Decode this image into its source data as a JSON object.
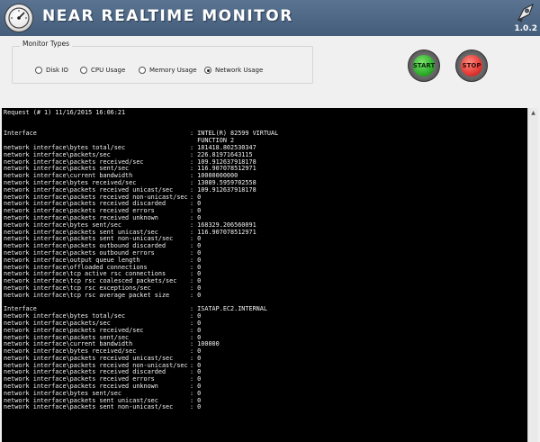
{
  "app": {
    "title": "NEAR REALTIME MONITOR",
    "version": "1.0.2"
  },
  "monitor_types": {
    "group_label": "Monitor Types",
    "options": [
      {
        "label": "Disk IO",
        "selected": false
      },
      {
        "label": "CPU Usage",
        "selected": false
      },
      {
        "label": "Memory Usage",
        "selected": false
      },
      {
        "label": "Network Usage",
        "selected": true
      }
    ]
  },
  "controls": {
    "start_label": "START",
    "stop_label": "STOP"
  },
  "console": {
    "request_line": "Request (# 1) 11/16/2015 16:06:21",
    "lines": [
      {
        "k": "",
        "v": ""
      },
      {
        "k": "",
        "v": ""
      },
      {
        "k": "Interface",
        "v": ": INTEL(R) 82599 VIRTUAL"
      },
      {
        "k": "",
        "v": "  FUNCTION 2"
      },
      {
        "k": "network interface\\bytes total/sec",
        "v": ": 181418.802530347"
      },
      {
        "k": "network interface\\packets/sec",
        "v": ": 226.81971643115"
      },
      {
        "k": "network interface\\packets received/sec",
        "v": ": 109.912637918178"
      },
      {
        "k": "network interface\\packets sent/sec",
        "v": ": 116.907078512971"
      },
      {
        "k": "network interface\\current bandwidth",
        "v": ": 10000000000"
      },
      {
        "k": "network interface\\bytes received/sec",
        "v": ": 13089.5959702558"
      },
      {
        "k": "network interface\\packets received unicast/sec",
        "v": ": 109.912637918178"
      },
      {
        "k": "network interface\\packets received non-unicast/sec",
        "v": ": 0"
      },
      {
        "k": "network interface\\packets received discarded",
        "v": ": 0"
      },
      {
        "k": "network interface\\packets received errors",
        "v": ": 0"
      },
      {
        "k": "network interface\\packets received unknown",
        "v": ": 0"
      },
      {
        "k": "network interface\\bytes sent/sec",
        "v": ": 168329.206560091"
      },
      {
        "k": "network interface\\packets sent unicast/sec",
        "v": ": 116.907078512971"
      },
      {
        "k": "network interface\\packets sent non-unicast/sec",
        "v": ": 0"
      },
      {
        "k": "network interface\\packets outbound discarded",
        "v": ": 0"
      },
      {
        "k": "network interface\\packets outbound errors",
        "v": ": 0"
      },
      {
        "k": "network interface\\output queue length",
        "v": ": 0"
      },
      {
        "k": "network interface\\offloaded connections",
        "v": ": 0"
      },
      {
        "k": "network interface\\tcp active rsc connections",
        "v": ": 0"
      },
      {
        "k": "network interface\\tcp rsc coalesced packets/sec",
        "v": ": 0"
      },
      {
        "k": "network interface\\tcp rsc exceptions/sec",
        "v": ": 0"
      },
      {
        "k": "network interface\\tcp rsc average packet size",
        "v": ": 0"
      },
      {
        "k": "",
        "v": ""
      },
      {
        "k": "Interface",
        "v": ": ISATAP.EC2.INTERNAL"
      },
      {
        "k": "network interface\\bytes total/sec",
        "v": ": 0"
      },
      {
        "k": "network interface\\packets/sec",
        "v": ": 0"
      },
      {
        "k": "network interface\\packets received/sec",
        "v": ": 0"
      },
      {
        "k": "network interface\\packets sent/sec",
        "v": ": 0"
      },
      {
        "k": "network interface\\current bandwidth",
        "v": ": 100000"
      },
      {
        "k": "network interface\\bytes received/sec",
        "v": ": 0"
      },
      {
        "k": "network interface\\packets received unicast/sec",
        "v": ": 0"
      },
      {
        "k": "network interface\\packets received non-unicast/sec",
        "v": ": 0"
      },
      {
        "k": "network interface\\packets received discarded",
        "v": ": 0"
      },
      {
        "k": "network interface\\packets received errors",
        "v": ": 0"
      },
      {
        "k": "network interface\\packets received unknown",
        "v": ": 0"
      },
      {
        "k": "network interface\\bytes sent/sec",
        "v": ": 0"
      },
      {
        "k": "network interface\\packets sent unicast/sec",
        "v": ": 0"
      },
      {
        "k": "network interface\\packets sent non-unicast/sec",
        "v": ": 0"
      }
    ]
  },
  "icons": {
    "logo": "gauge-icon",
    "corner": "rocket-badge-icon"
  },
  "colors": {
    "header": "#4d6785",
    "console_bg": "#000000",
    "console_text": "#f2f2f2",
    "start": "#2fae2b",
    "stop": "#e53935"
  }
}
